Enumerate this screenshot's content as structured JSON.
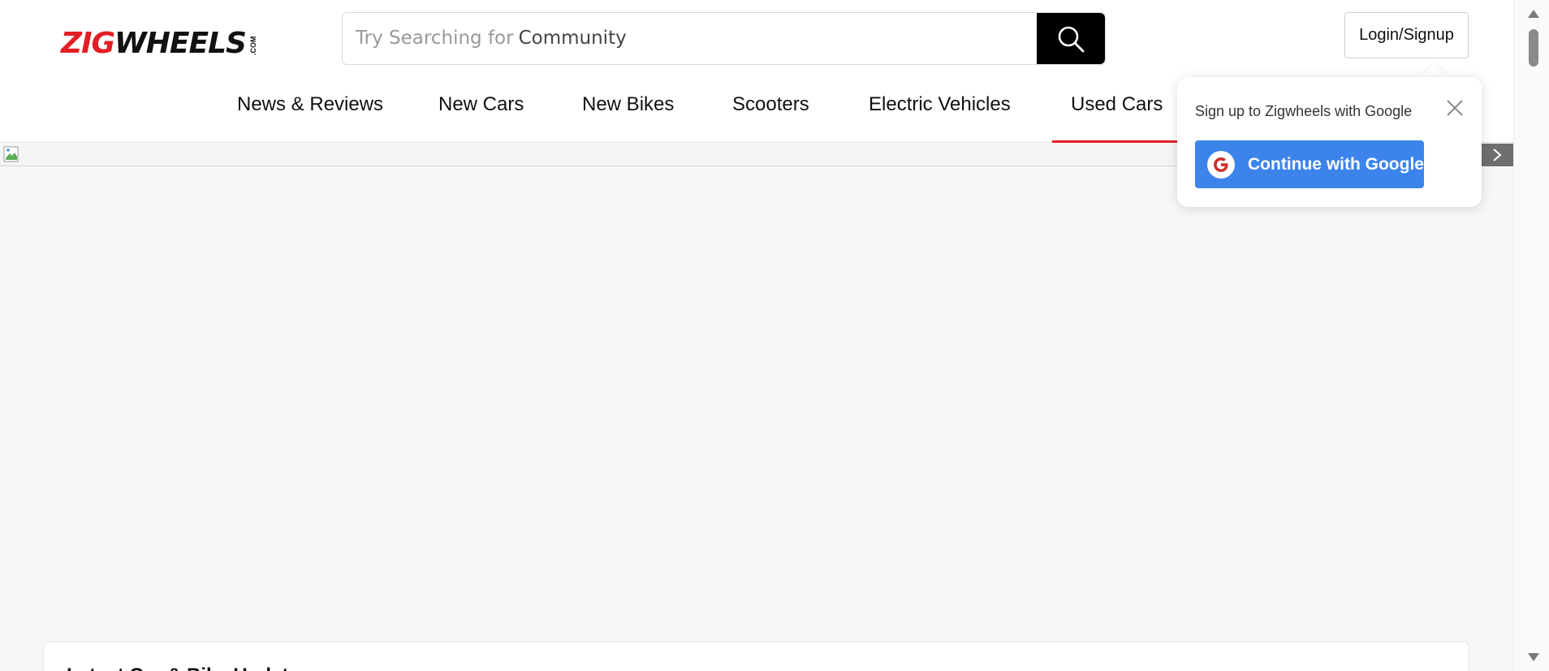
{
  "header": {
    "logo": {
      "part1": "ZIG",
      "part2": "WHEELS",
      "suffix": ".COM"
    },
    "search": {
      "hint_prefix": "Try Searching for",
      "hint_word": "Community"
    },
    "login_label": "Login/Signup"
  },
  "nav": {
    "items": [
      {
        "label": "News & Reviews"
      },
      {
        "label": "New Cars"
      },
      {
        "label": "New Bikes"
      },
      {
        "label": "Scooters"
      },
      {
        "label": "Electric Vehicles"
      },
      {
        "label": "Used Cars",
        "active": true
      }
    ]
  },
  "popup": {
    "title": "Sign up to Zigwheels with Google",
    "button_label": "Continue with Google"
  },
  "card": {
    "title": "Latest Car & Bike Updates"
  },
  "colors": {
    "brand_red": "#e31e25",
    "google_blue": "#3c84ec",
    "search_button": "#000000"
  },
  "icons": [
    "search-icon",
    "close-icon",
    "google-icon",
    "broken-image-icon",
    "chevron-right-icon"
  ]
}
